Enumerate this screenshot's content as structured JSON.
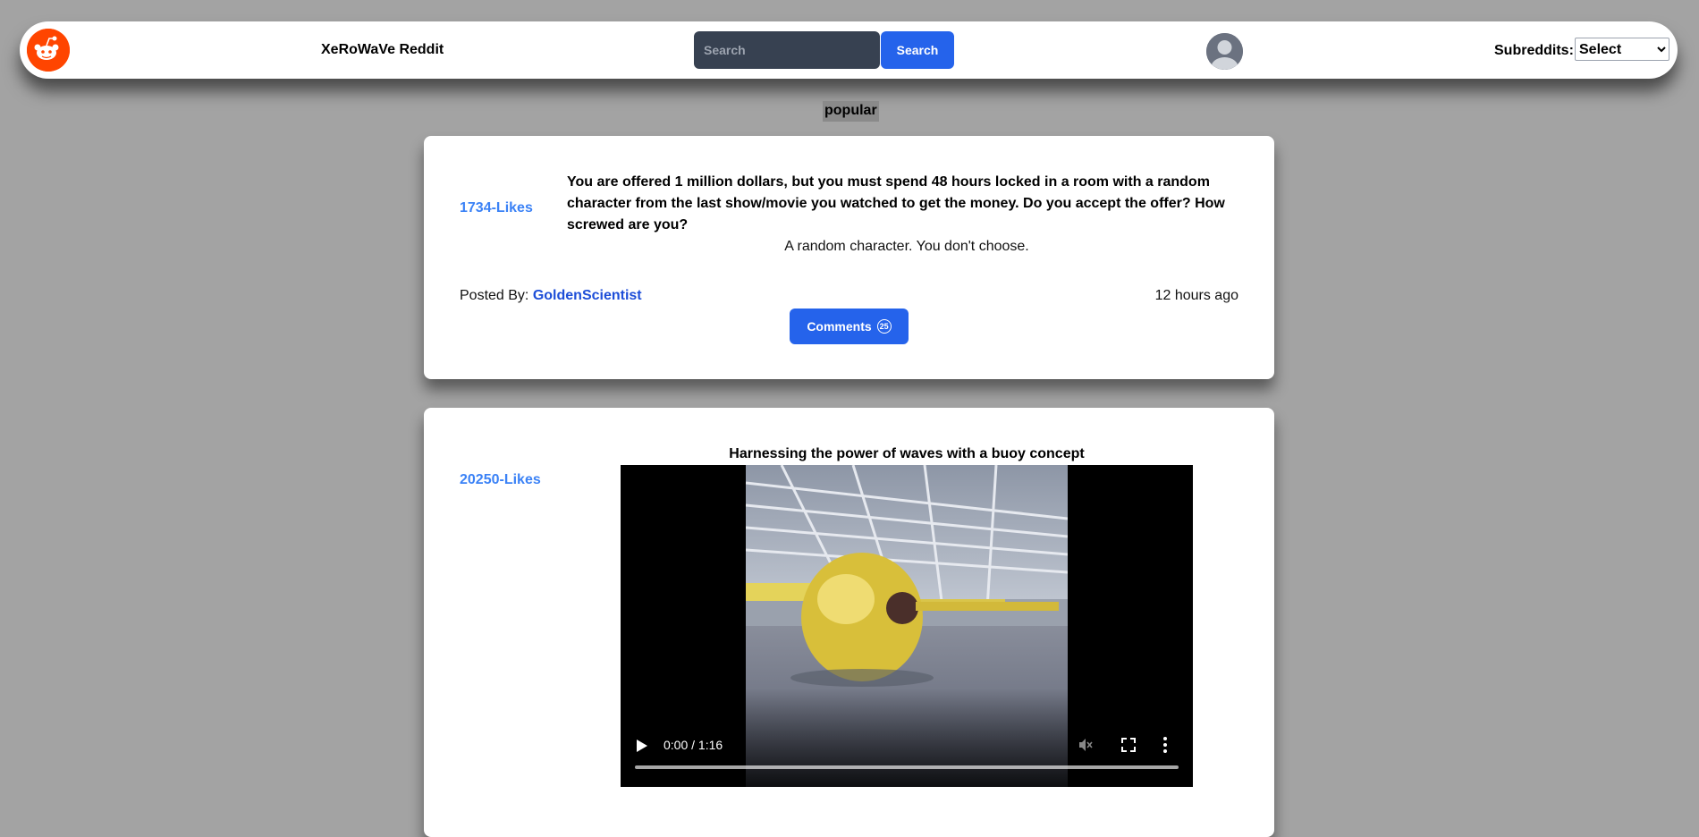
{
  "navbar": {
    "app_title": "XeRoWaVe Reddit",
    "search_placeholder": "Search",
    "search_button": "Search",
    "subreddits_label": "Subreddits:",
    "subreddits_selected": "Select",
    "logo_icon": "reddit-alien-icon",
    "avatar_icon": "user-avatar-icon",
    "brand_color": "#ff4500",
    "accent_color": "#2563eb"
  },
  "category": "popular",
  "posts": [
    {
      "likes": "1734-Likes",
      "title": "You are offered 1 million dollars, but you must spend 48 hours locked in a room with a random character from the last show/movie you watched to get the money. Do you accept the offer? How screwed are you?",
      "body": "A random character. You don't choose.",
      "posted_by_label": "Posted By:",
      "author": "GoldenScientist",
      "time": "12 hours ago",
      "comments_label": "Comments",
      "comments_count": "25"
    },
    {
      "likes": "20250-Likes",
      "title": "Harnessing the power of waves with a buoy concept",
      "video": {
        "time": "0:00 / 1:16",
        "progress": 0,
        "icons": [
          "play-icon",
          "mute-icon",
          "fullscreen-icon",
          "more-options-icon"
        ]
      }
    }
  ]
}
